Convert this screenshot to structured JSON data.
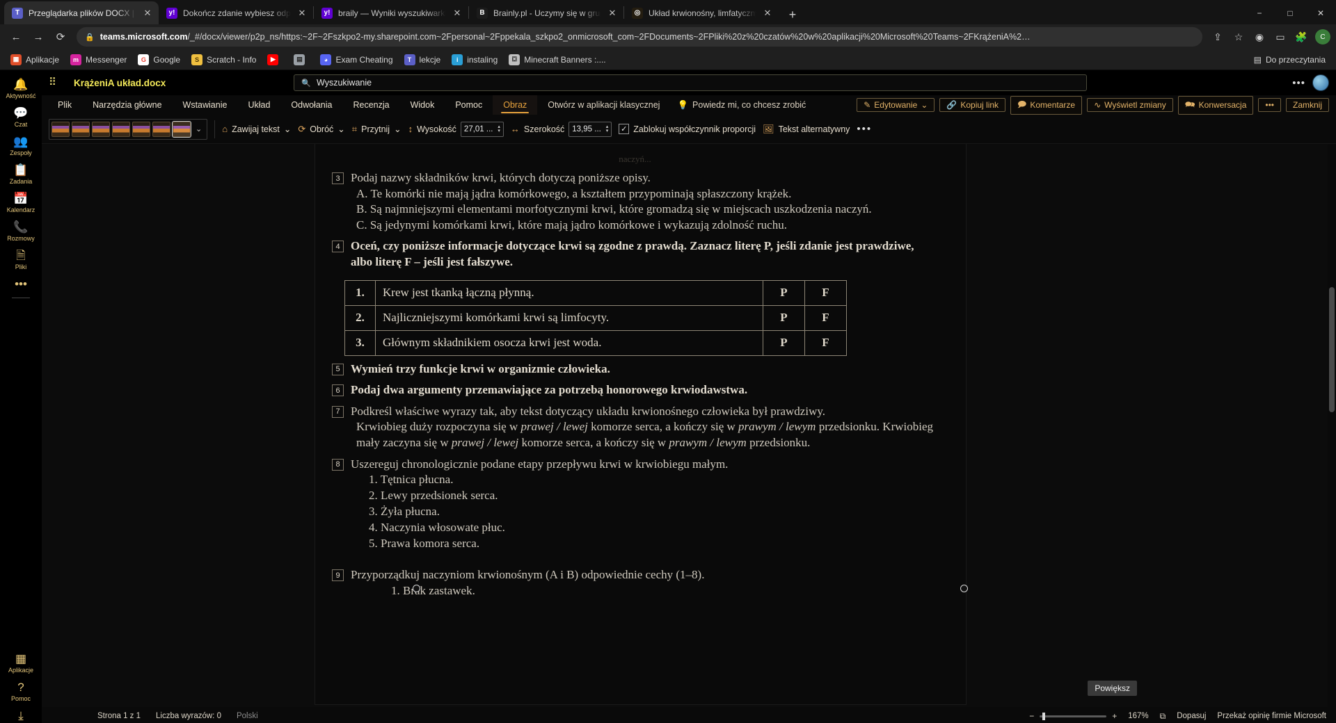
{
  "browser": {
    "tabs": [
      {
        "title": "Przeglądarka plików DOCX | Mic",
        "favicon": "teams-icon",
        "active": true
      },
      {
        "title": "Dokończ zdanie wybiesz odpowi",
        "favicon": "yahoo-icon",
        "active": false
      },
      {
        "title": "braily — Wyniki wyszukiwarki Yah",
        "favicon": "yahoo-icon",
        "active": false
      },
      {
        "title": "Brainly.pl - Uczymy się w grupie",
        "favicon": "brainly-icon",
        "active": false
      },
      {
        "title": "Układ krwionośny, limfatyczny i o",
        "favicon": "spiral-icon",
        "active": false
      }
    ],
    "new_tab_label": "+",
    "window_controls": [
      "−",
      "□",
      "✕"
    ],
    "nav": {
      "back": "←",
      "forward": "→",
      "reload": "⟳",
      "lock_icon": "lock-icon",
      "url_prefix": "https://",
      "url_host": "teams.microsoft.com",
      "url_path": "/_#/docx/viewer/p2p_ns/https:~2F~2Fszkpo2-my.sharepoint.com~2Fpersonal~2Fppekala_szkpo2_onmicrosoft_com~2FDocuments~2FPliki%20z%20czatów%20w%20aplikacji%20Microsoft%20Teams~2FKrążeniA%2…",
      "right_icons": [
        "share-icon",
        "star-icon",
        "shield-icon",
        "cast-icon",
        "puzzle-icon"
      ],
      "profile_initial": "C"
    },
    "bookmarks": [
      {
        "label": "Aplikacje",
        "icon": "apps-grid-icon",
        "color": "#e04f2a"
      },
      {
        "label": "Messenger",
        "icon": "messenger-icon",
        "color": "#d6249f"
      },
      {
        "label": "Google",
        "icon": "google-icon",
        "color": "#ffffff"
      },
      {
        "label": "Scratch - Info",
        "icon": "scratch-icon",
        "color": "#f0c040"
      },
      {
        "label": "",
        "icon": "youtube-icon",
        "color": "#ff0000"
      },
      {
        "label": "",
        "icon": "page-icon",
        "color": "#9aa0a6"
      },
      {
        "label": "Exam Cheating",
        "icon": "discord-icon",
        "color": "#5865f2"
      },
      {
        "label": "lekcje",
        "icon": "teams-icon",
        "color": "#5b5fc7"
      },
      {
        "label": "instaling",
        "icon": "instaling-icon",
        "color": "#2a9fd6"
      },
      {
        "label": "Minecraft Banners :....",
        "icon": "banner-icon",
        "color": "#c0c0c0"
      }
    ],
    "reading_list": {
      "label": "Do przeczytania",
      "icon": "reading-list-icon"
    }
  },
  "teams": {
    "rail": [
      {
        "label": "Aktywność",
        "icon": "bell-icon"
      },
      {
        "label": "Czat",
        "icon": "chat-icon"
      },
      {
        "label": "Zespoły",
        "icon": "teams-people-icon"
      },
      {
        "label": "Zadania",
        "icon": "assignments-icon"
      },
      {
        "label": "Kalendarz",
        "icon": "calendar-icon"
      },
      {
        "label": "Rozmowy",
        "icon": "phone-icon"
      },
      {
        "label": "Pliki",
        "icon": "files-icon"
      },
      {
        "label": "",
        "icon": "more-dots-icon"
      }
    ],
    "rail_bottom": [
      {
        "label": "Aplikacje",
        "icon": "apps-icon"
      },
      {
        "label": "Pomoc",
        "icon": "help-icon"
      },
      {
        "label": "",
        "icon": "download-icon"
      }
    ],
    "header": {
      "waffle": "waffle-icon",
      "doc_name": "KrążeniA układ.docx",
      "search_placeholder": "Wyszukiwanie",
      "search_icon": "search-icon",
      "more_dots": "•••",
      "avatar": "user-avatar"
    }
  },
  "ribbon": {
    "tabs": [
      {
        "label": "Plik",
        "active": false
      },
      {
        "label": "Narzędzia główne",
        "active": false
      },
      {
        "label": "Wstawianie",
        "active": false
      },
      {
        "label": "Układ",
        "active": false
      },
      {
        "label": "Odwołania",
        "active": false
      },
      {
        "label": "Recenzja",
        "active": false
      },
      {
        "label": "Widok",
        "active": false
      },
      {
        "label": "Pomoc",
        "active": false
      },
      {
        "label": "Obraz",
        "active": true
      }
    ],
    "open_in_desktop": "Otwórz w aplikacji klasycznej",
    "tell_me": "Powiedz mi, co chcesz zrobić",
    "tell_me_icon": "lightbulb-icon",
    "editing": "Edytowanie",
    "editing_icon": "pencil-icon",
    "copy_link": "Kopiuj link",
    "copy_link_icon": "link-icon",
    "comments": "Komentarze",
    "comments_icon": "comment-icon",
    "show_changes": "Wyświetl zmiany",
    "show_changes_icon": "changes-icon",
    "conversation": "Konwersacja",
    "conversation_icon": "conversation-icon",
    "more": "•••",
    "close": "Zamknij"
  },
  "image_toolbar": {
    "gallery_count": 7,
    "gallery_selected_index": 6,
    "gallery_caret": "chevron-down-icon",
    "wrap_text": "Zawijaj tekst",
    "wrap_text_icon": "wrap-text-icon",
    "rotate": "Obróć",
    "rotate_icon": "rotate-icon",
    "crop": "Przytnij",
    "crop_icon": "crop-icon",
    "height_label": "Wysokość",
    "height_icon": "height-icon",
    "height_value": "27,01 ...",
    "width_label": "Szerokość",
    "width_icon": "width-icon",
    "width_value": "13,95 ...",
    "lock_aspect": "Zablokuj współczynnik proporcji",
    "lock_aspect_checked": true,
    "alt_text": "Tekst alternatywny",
    "alt_text_icon": "alt-text-icon",
    "more": "•••"
  },
  "document": {
    "top_faint": "naczyń...",
    "questions": [
      {
        "num": "3",
        "title": "Podaj nazwy składników krwi, których dotyczą poniższe opisy.",
        "lines": [
          "A. Te komórki nie mają jądra komórkowego, a kształtem przypominają spłaszczony krążek.",
          "B. Są najmniejszymi elementami morfotycznymi krwi, które gromadzą się w miejscach uszkodzenia naczyń.",
          "C. Są jedynymi komórkami krwi, które mają jądro komórkowe i wykazują zdolność ruchu."
        ]
      },
      {
        "num": "4",
        "title": "Oceń, czy poniższe informacje dotyczące krwi są zgodne z prawdą. Zaznacz literę P, jeśli zdanie jest prawdziwe, albo literę F – jeśli jest fałszywe.",
        "lines": []
      },
      {
        "num": "5",
        "title": "Wymień trzy funkcje krwi w organizmie człowieka.",
        "lines": []
      },
      {
        "num": "6",
        "title": "Podaj dwa argumenty przemawiające za potrzebą honorowego krwiodawstwa.",
        "lines": []
      },
      {
        "num": "7",
        "title": "Podkreśl właściwe wyrazy tak, aby tekst dotyczący układu krwionośnego człowieka był prawdziwy.",
        "lines": []
      },
      {
        "num": "8",
        "title": "Uszereguj chronologicznie podane etapy przepływu krwi w krwiobiegu małym.",
        "lines": []
      },
      {
        "num": "9",
        "title": "Przyporządkuj naczyniom krwionośnym (A i B) odpowiednie cechy (1–8).",
        "lines": []
      }
    ],
    "tf_table": {
      "rows": [
        {
          "idx": "1.",
          "text": "Krew jest tkanką łączną płynną.",
          "p": "P",
          "f": "F"
        },
        {
          "idx": "2.",
          "text": "Najliczniejszymi komórkami krwi są limfocyty.",
          "p": "P",
          "f": "F"
        },
        {
          "idx": "3.",
          "text": "Głównym składnikiem osocza krwi jest woda.",
          "p": "P",
          "f": "F"
        }
      ]
    },
    "q7_text_parts": [
      "Krwiobieg duży rozpoczyna się w ",
      "prawej / lewej",
      " komorze serca, a kończy się w ",
      "prawym / lewym",
      " przedsionku. Krwiobieg mały zaczyna się w ",
      "prawej / lewej",
      " komorze serca, a kończy się w ",
      "prawym / lewym",
      " przedsionku."
    ],
    "q8_list": [
      "1. Tętnica płucna.",
      "2. Lewy przedsionek serca.",
      "3. Żyła płucna.",
      "4. Naczynia włosowate płuc.",
      "5. Prawa komora serca."
    ],
    "q9_list": [
      "1. Brak zastawek."
    ],
    "zoom_tooltip": "Powiększ"
  },
  "statusbar": {
    "page": "Strona 1 z 1",
    "words": "Liczba wyrazów: 0",
    "language": "Polski",
    "zoom_out": "−",
    "zoom_in": "+",
    "zoom_level": "167%",
    "fit": "Dopasuj",
    "fit_icon": "fit-page-icon",
    "feedback": "Przekaż opinię firmie Microsoft"
  }
}
